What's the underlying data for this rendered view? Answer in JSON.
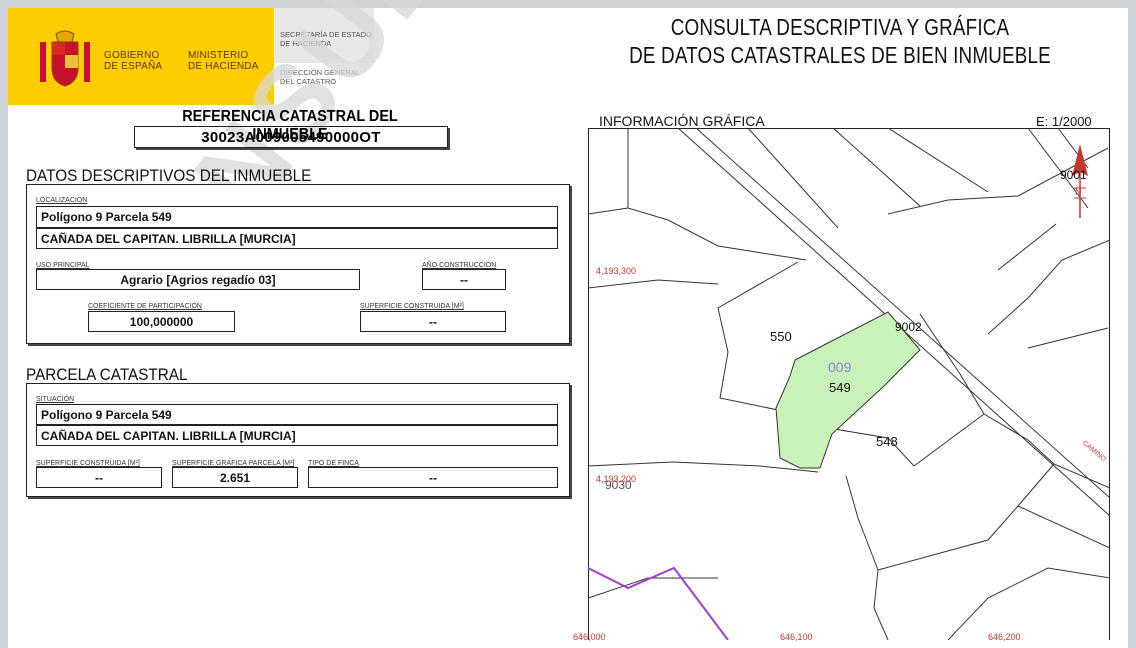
{
  "header": {
    "gov_line1": "GOBIERNO",
    "gov_line2": "DE ESPAÑA",
    "min_line1": "MINISTERIO",
    "min_line2": "DE HACIENDA",
    "sec_line1": "SECRETARÍA DE ESTADO",
    "sec_line2": "DE HACIENDA",
    "dir_line1": "DIRECCIÓN GENERAL",
    "dir_line2": "DEL CATASTRO"
  },
  "title": {
    "line1": "CONSULTA DESCRIPTIVA Y GRÁFICA",
    "line2": "DE DATOS CATASTRALES DE BIEN INMUEBLE"
  },
  "referencia": {
    "heading": "REFERENCIA CATASTRAL DEL INMUEBLE",
    "value": "30023A009005490000OT"
  },
  "datos": {
    "heading": "DATOS DESCRIPTIVOS DEL INMUEBLE",
    "localizacion_label": "LOCALIZACIÓN",
    "localizacion_line1": "Polígono 9 Parcela 549",
    "localizacion_line2": "CAÑADA DEL CAPITAN. LIBRILLA [MURCIA]",
    "uso_label": "USO PRINCIPAL",
    "uso_value": "Agrario [Agrios regadío 03]",
    "anio_label": "AÑO CONSTRUCCIÓN",
    "anio_value": "--",
    "coef_label": "COEFICIENTE DE PARTICIPACIÓN",
    "coef_value": "100,000000",
    "sup_label": "SUPERFICIE CONSTRUIDA [m²]",
    "sup_value": "--"
  },
  "parcela": {
    "heading": "PARCELA CATASTRAL",
    "situacion_label": "SITUACIÓN",
    "situacion_line1": "Polígono 9 Parcela 549",
    "situacion_line2": "CAÑADA DEL CAPITAN. LIBRILLA [MURCIA]",
    "supcons_label": "SUPERFICIE CONSTRUIDA [m²]",
    "supcons_value": "--",
    "supgraf_label": "SUPERFICIE GRÁFICA PARCELA [m²]",
    "supgraf_value": "2.651",
    "tipo_label": "TIPO DE FINCA",
    "tipo_value": "--"
  },
  "watermark": "CONSULTA",
  "map": {
    "heading": "INFORMACIÓN GRÁFICA",
    "scale": "E: 1/2000",
    "parcels": {
      "p550": "550",
      "p549": "549",
      "p548": "548",
      "poly": "009",
      "p9002": "9002",
      "p9030": "9030",
      "p9001": "9001"
    },
    "coords": {
      "y1": "4,193,300",
      "y2": "4,193,200",
      "x1": "646,000",
      "x2": "646,100",
      "x3": "646,200"
    },
    "road_label": "CAMINO",
    "north": "N",
    "colors": {
      "highlight": "#c8f2b8",
      "coord": "#c0392b",
      "boundary": "#a040d0"
    }
  }
}
